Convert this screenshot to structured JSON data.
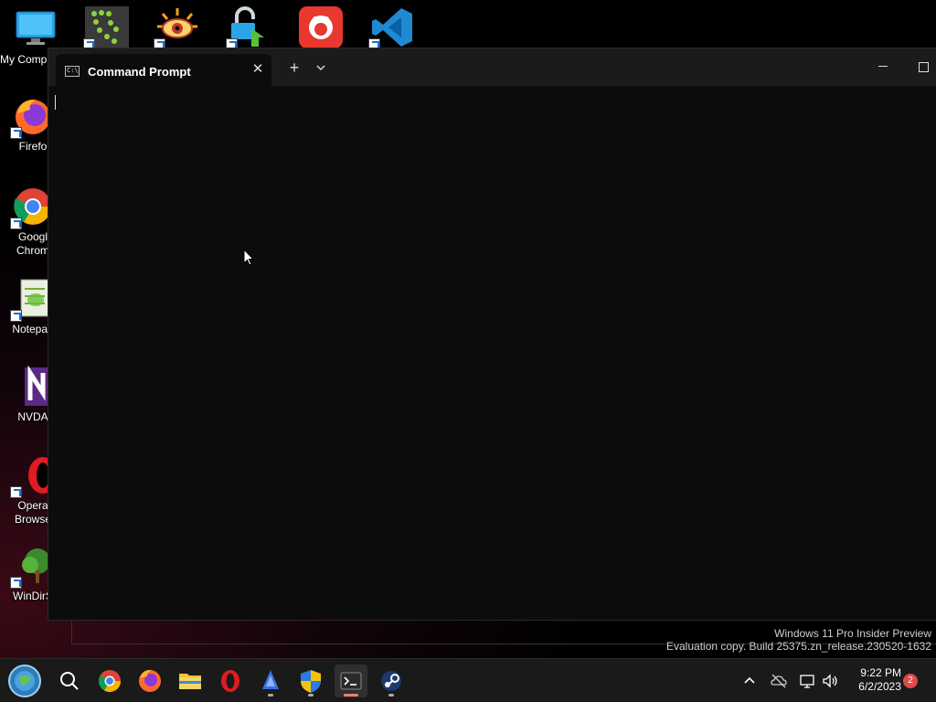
{
  "desktop": {
    "icons": [
      {
        "label": "My Comp",
        "icon": "computer-icon"
      },
      {
        "label": "Firefo",
        "icon": "firefox-icon"
      },
      {
        "label": "Googl\nChrom",
        "icon": "chrome-icon"
      },
      {
        "label": "Notepad",
        "icon": "notepad-icon"
      },
      {
        "label": "NVDA",
        "icon": "nvda-icon"
      },
      {
        "label": "Opera\nBrowse",
        "icon": "opera-icon"
      },
      {
        "label": "WinDirS",
        "icon": "windirstat-icon"
      }
    ],
    "top_row_icons": [
      "greenshot-icon",
      "xnview-icon",
      "app-unlocker-icon",
      "record-app-icon",
      "vscode-icon"
    ]
  },
  "terminal": {
    "tab_title": "Command Prompt",
    "tab_icon_text": "C:\\",
    "close_glyph": "✕",
    "new_tab_glyph": "+",
    "maximize_label": "Maximize"
  },
  "watermark": {
    "line1": "Windows 11 Pro Insider Preview",
    "line2": "Evaluation copy. Build 25375.zn_release.230520-1632"
  },
  "taskbar": {
    "apps": [
      "start-icon",
      "search-icon",
      "chrome-icon",
      "firefox-icon",
      "file-explorer-icon",
      "opera-icon",
      "app-icon",
      "security-shield-icon",
      "terminal-icon",
      "steam-icon"
    ],
    "time": "9:22 PM",
    "date": "6/2/2023",
    "notification_count": "2"
  },
  "colors": {
    "terminal_bg": "#0c0c0c",
    "titlebar_bg": "#1b1b1b",
    "taskbar_bg": "#1a1a1a",
    "accent_indicator": "#f47a7a"
  }
}
